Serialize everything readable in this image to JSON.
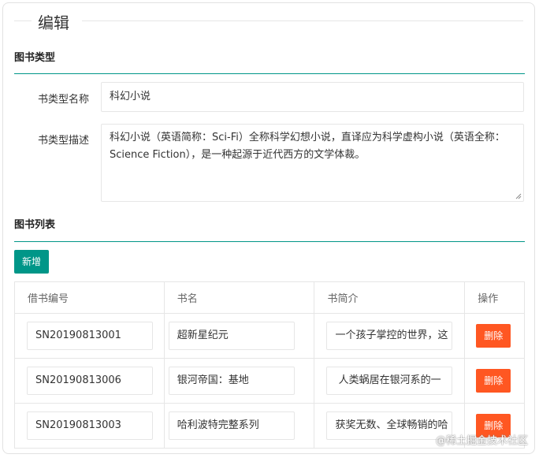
{
  "form": {
    "legend": "编辑",
    "section_type_title": "图书类型",
    "type_name_label": "书类型名称",
    "type_name_value": "科幻小说",
    "type_desc_label": "书类型描述",
    "type_desc_value": "科幻小说（英语简称：Sci-Fi）全称科学幻想小说，直译应为科学虚构小说（英语全称：Science Fiction），是一种起源于近代西方的文学体裁。",
    "section_list_title": "图书列表",
    "add_button": "新增"
  },
  "table": {
    "headers": [
      "借书编号",
      "书名",
      "书简介",
      "操作"
    ],
    "rows": [
      {
        "id": "SN20190813001",
        "name": "超新星纪元",
        "intro": "一个孩子掌控的世界，这",
        "action": "删除"
      },
      {
        "id": "SN20190813006",
        "name": "银河帝国：基地",
        "intro": " 人类蜗居在银河系的一",
        "action": "删除"
      },
      {
        "id": "SN20190813003",
        "name": "哈利波特完整系列",
        "intro": "获奖无数、全球畅销的哈",
        "action": "删除"
      }
    ]
  },
  "watermark": "@稀土掘金技术社区",
  "colors": {
    "primary": "#009688",
    "danger": "#ff5722",
    "border": "#e6e6e6"
  }
}
